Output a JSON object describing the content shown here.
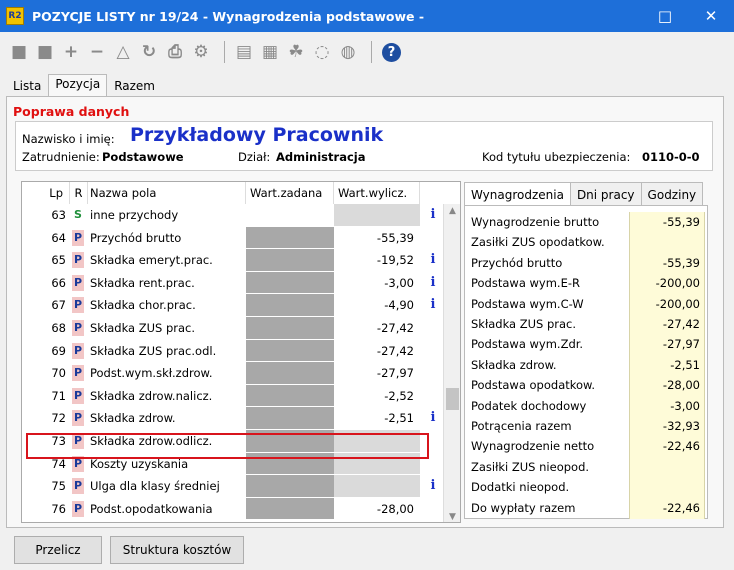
{
  "window": {
    "title": "POZYCJE LISTY nr 19/24 - Wynagrodzenia podstawowe -",
    "app_badge": "R2",
    "minimize": "□",
    "close": "✕"
  },
  "toolbar": {
    "icons": [
      "first-record-icon",
      "next-record-icon",
      "add-icon",
      "delete-icon",
      "edit-icon",
      "refresh-icon",
      "print-icon",
      "settings-icon",
      "report-icon",
      "report2-icon",
      "users-icon",
      "sync-icon",
      "undo-icon",
      "help-icon"
    ],
    "help": "?"
  },
  "tabs": [
    "Lista",
    "Pozycja",
    "Razem"
  ],
  "section_title": "Poprawa danych",
  "employee": {
    "name_label": "Nazwisko i imię:",
    "name": "Przykładowy Pracownik",
    "employment_label": "Zatrudnienie:",
    "employment": "Podstawowe",
    "department_label": "Dział:",
    "department": "Administracja",
    "insurance_label": "Kod tytułu ubezpieczenia:",
    "insurance_code": "0110-0-0"
  },
  "table": {
    "headers": {
      "lp": "Lp",
      "r": "R",
      "name": "Nazwa pola",
      "set": "Wart.zadana",
      "calc": "Wart.wylicz."
    },
    "rows": [
      {
        "lp": "63",
        "r": "S",
        "name": "inne przychody",
        "set": "",
        "calc": "",
        "info": "i"
      },
      {
        "lp": "64",
        "r": "P",
        "name": "Przychód brutto",
        "set": "",
        "calc": "-55,39",
        "info": ""
      },
      {
        "lp": "65",
        "r": "P",
        "name": "Składka emeryt.prac.",
        "set": "",
        "calc": "-19,52",
        "info": "i"
      },
      {
        "lp": "66",
        "r": "P",
        "name": "Składka rent.prac.",
        "set": "",
        "calc": "-3,00",
        "info": "i"
      },
      {
        "lp": "67",
        "r": "P",
        "name": "Składka chor.prac.",
        "set": "",
        "calc": "-4,90",
        "info": "i"
      },
      {
        "lp": "68",
        "r": "P",
        "name": "Składka ZUS prac.",
        "set": "",
        "calc": "-27,42",
        "info": ""
      },
      {
        "lp": "69",
        "r": "P",
        "name": "Składka ZUS prac.odl.",
        "set": "",
        "calc": "-27,42",
        "info": ""
      },
      {
        "lp": "70",
        "r": "P",
        "name": "Podst.wym.skł.zdrow.",
        "set": "",
        "calc": "-27,97",
        "info": ""
      },
      {
        "lp": "71",
        "r": "P",
        "name": "Składka zdrow.nalicz.",
        "set": "",
        "calc": "-2,52",
        "info": ""
      },
      {
        "lp": "72",
        "r": "P",
        "name": "Składka zdrow.",
        "set": "",
        "calc": "-2,51",
        "info": "i"
      },
      {
        "lp": "73",
        "r": "P",
        "name": "Składka zdrow.odlicz.",
        "set": "",
        "calc": "",
        "info": ""
      },
      {
        "lp": "74",
        "r": "P",
        "name": "Koszty uzyskania",
        "set": "",
        "calc": "",
        "info": ""
      },
      {
        "lp": "75",
        "r": "P",
        "name": "Ulga dla klasy średniej",
        "set": "",
        "calc": "",
        "info": "i"
      },
      {
        "lp": "76",
        "r": "P",
        "name": "Podst.opodatkowania",
        "set": "",
        "calc": "-28,00",
        "info": ""
      }
    ]
  },
  "right_tabs": [
    "Wynagrodzenia",
    "Dni pracy",
    "Godziny"
  ],
  "summary": [
    {
      "label": "Wynagrodzenie brutto",
      "value": "-55,39"
    },
    {
      "label": "Zasiłki ZUS opodatkow.",
      "value": ""
    },
    {
      "label": "Przychód brutto",
      "value": "-55,39"
    },
    {
      "label": "Podstawa wym.E-R",
      "value": "-200,00"
    },
    {
      "label": "Podstawa wym.C-W",
      "value": "-200,00"
    },
    {
      "label": "Składka ZUS prac.",
      "value": "-27,42"
    },
    {
      "label": "Podstawa wym.Zdr.",
      "value": "-27,97"
    },
    {
      "label": "Składka zdrow.",
      "value": "-2,51"
    },
    {
      "label": "Podstawa opodatkow.",
      "value": "-28,00"
    },
    {
      "label": "Podatek dochodowy",
      "value": "-3,00"
    },
    {
      "label": "Potrącenia razem",
      "value": "-32,93"
    },
    {
      "label": "Wynagrodzenie netto",
      "value": "-22,46"
    },
    {
      "label": "Zasiłki ZUS nieopod.",
      "value": ""
    },
    {
      "label": "Dodatki nieopod.",
      "value": ""
    },
    {
      "label": "Do wypłaty razem",
      "value": "-22,46"
    }
  ],
  "buttons": {
    "recalc": "Przelicz",
    "costs": "Struktura kosztów"
  },
  "colors": {
    "titlebar": "#1e6fd9",
    "name": "#1a30c8",
    "section": "#e01010",
    "highlight": "#d8141c"
  }
}
